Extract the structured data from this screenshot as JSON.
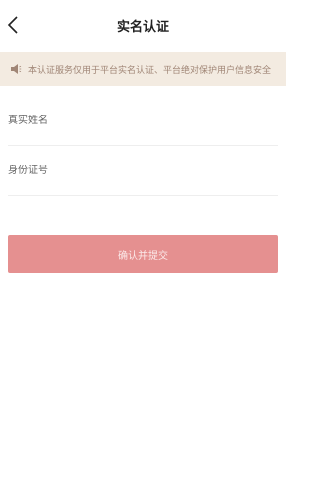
{
  "header": {
    "title": "实名认证",
    "back_icon": "chevron-left-icon"
  },
  "notice": {
    "icon": "speaker-icon",
    "text": "本认证服务仅用于平台实名认证、平台绝对保护用户信息安全"
  },
  "form": {
    "name_placeholder": "真实姓名",
    "name_value": "",
    "id_placeholder": "身份证号",
    "id_value": ""
  },
  "submit": {
    "label": "确认并提交"
  },
  "colors": {
    "notice_bg": "#f3ebe1",
    "notice_text": "#a08676",
    "button_bg": "#e59090",
    "button_text": "#fbe9e9"
  }
}
